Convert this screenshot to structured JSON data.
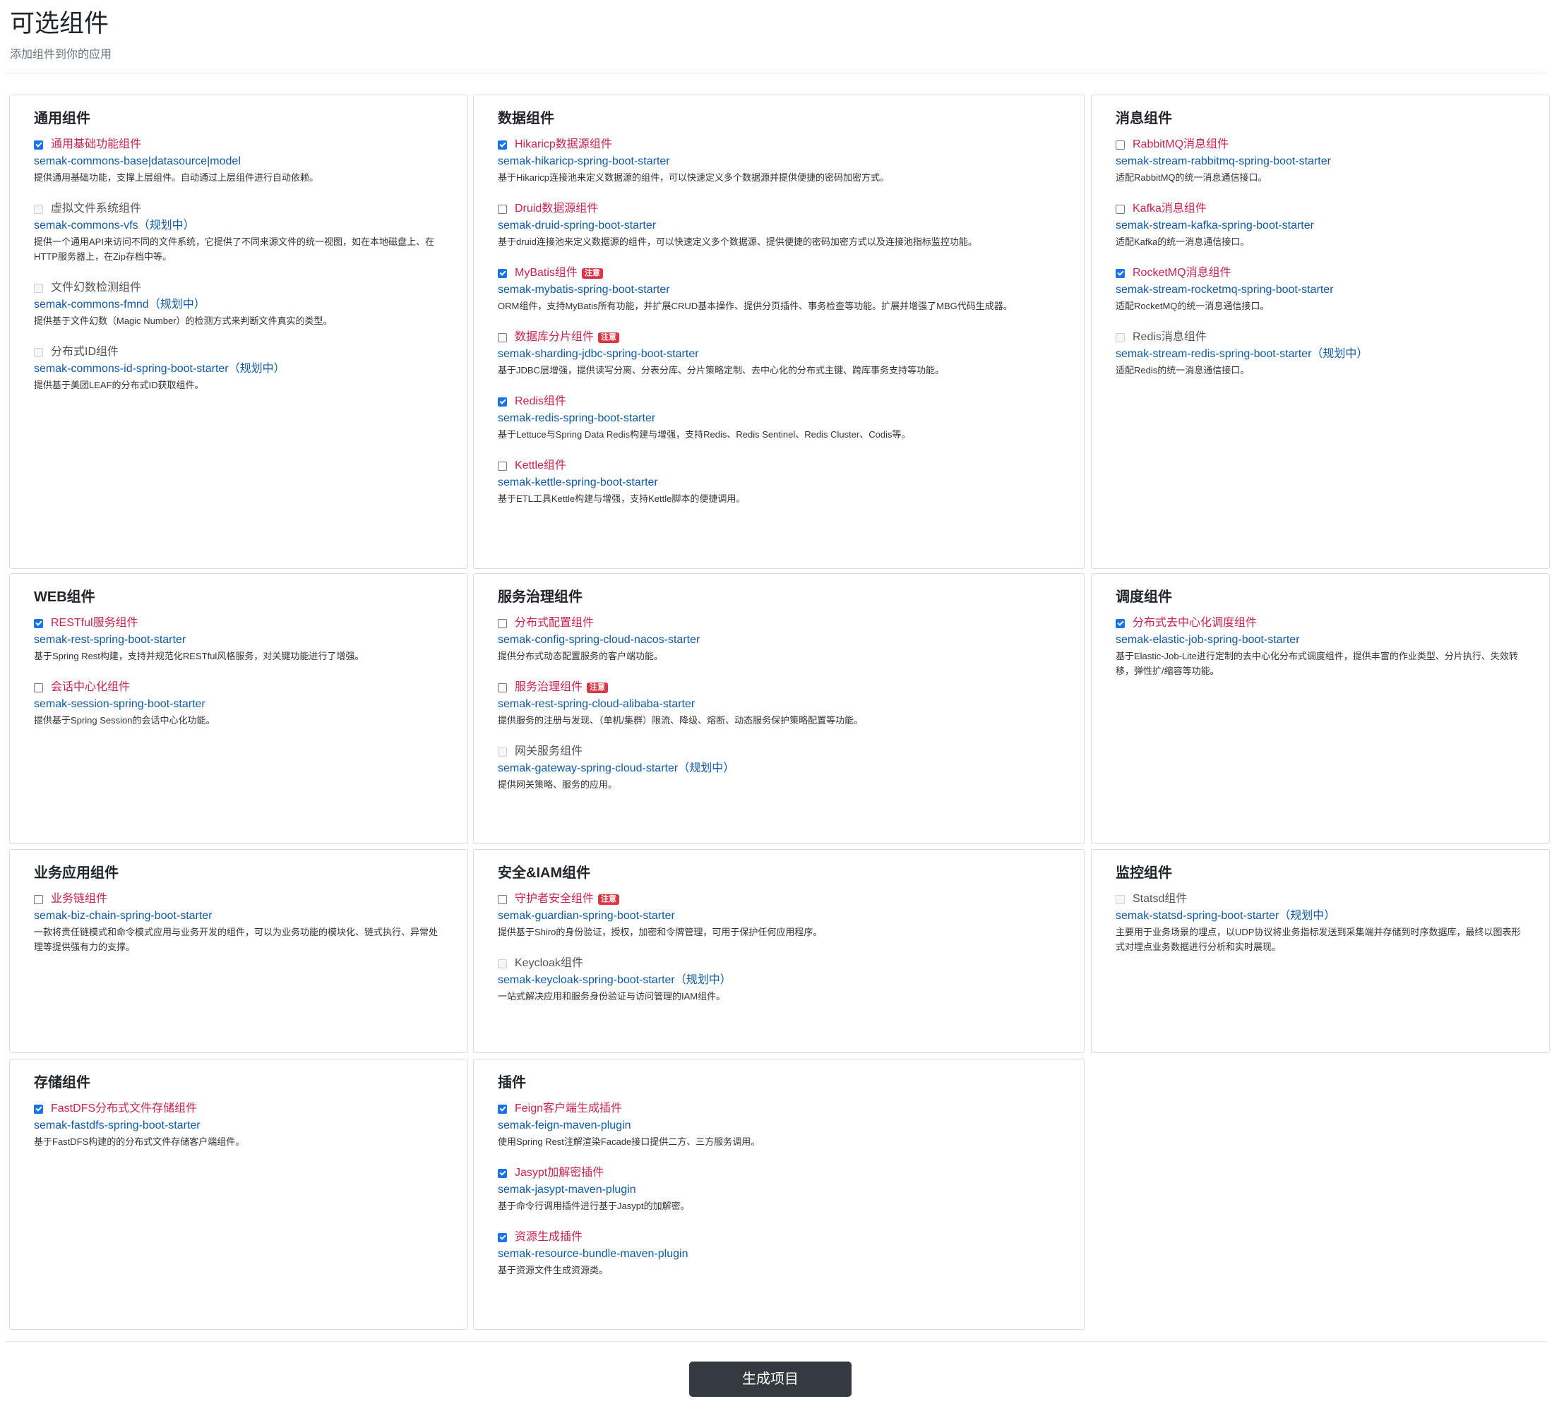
{
  "page": {
    "title": "可选组件",
    "subtitle": "添加组件到你的应用",
    "generate_label": "生成项目"
  },
  "badge_label": "注意",
  "cards": [
    {
      "title": "通用组件",
      "items": [
        {
          "name": "通用基础功能组件",
          "state": "checked",
          "artifact": "semak-commons-base|datasource|model",
          "desc": "提供通用基础功能，支撑上层组件。自动通过上层组件进行自动依赖。"
        },
        {
          "name": "虚拟文件系统组件",
          "state": "disabled",
          "artifact": "semak-commons-vfs（规划中）",
          "desc": "提供一个通用API来访问不同的文件系统，它提供了不同来源文件的统一视图，如在本地磁盘上、在HTTP服务器上，在Zip存档中等。"
        },
        {
          "name": "文件幻数检测组件",
          "state": "disabled",
          "artifact": "semak-commons-fmnd（规划中）",
          "desc": "提供基于文件幻数（Magic Number）的检测方式来判断文件真实的类型。"
        },
        {
          "name": "分布式ID组件",
          "state": "disabled",
          "artifact": "semak-commons-id-spring-boot-starter（规划中）",
          "desc": "提供基于美团LEAF的分布式ID获取组件。"
        }
      ]
    },
    {
      "title": "数据组件",
      "items": [
        {
          "name": "Hikaricp数据源组件",
          "state": "checked",
          "artifact": "semak-hikaricp-spring-boot-starter",
          "desc": "基于Hikaricp连接池来定义数据源的组件，可以快速定义多个数据源并提供便捷的密码加密方式。"
        },
        {
          "name": "Druid数据源组件",
          "state": "unchecked",
          "artifact": "semak-druid-spring-boot-starter",
          "desc": "基于druid连接池来定义数据源的组件，可以快速定义多个数据源、提供便捷的密码加密方式以及连接池指标监控功能。"
        },
        {
          "name": "MyBatis组件",
          "state": "checked",
          "badge": true,
          "artifact": "semak-mybatis-spring-boot-starter",
          "desc": "ORM组件，支持MyBatis所有功能，并扩展CRUD基本操作、提供分页插件、事务检查等功能。扩展并增强了MBG代码生成器。"
        },
        {
          "name": "数据库分片组件",
          "state": "unchecked",
          "badge": true,
          "artifact": "semak-sharding-jdbc-spring-boot-starter",
          "desc": "基于JDBC层增强，提供读写分离、分表分库、分片策略定制、去中心化的分布式主键、跨库事务支持等功能。"
        },
        {
          "name": "Redis组件",
          "state": "checked",
          "artifact": "semak-redis-spring-boot-starter",
          "desc": "基于Lettuce与Spring Data Redis构建与增强，支持Redis、Redis Sentinel、Redis Cluster、Codis等。"
        },
        {
          "name": "Kettle组件",
          "state": "unchecked",
          "artifact": "semak-kettle-spring-boot-starter",
          "desc": "基于ETL工具Kettle构建与增强，支持Kettle脚本的便捷调用。"
        }
      ]
    },
    {
      "title": "消息组件",
      "items": [
        {
          "name": "RabbitMQ消息组件",
          "state": "unchecked",
          "artifact": "semak-stream-rabbitmq-spring-boot-starter",
          "desc": "适配RabbitMQ的统一消息通信接口。"
        },
        {
          "name": "Kafka消息组件",
          "state": "unchecked",
          "artifact": "semak-stream-kafka-spring-boot-starter",
          "desc": "适配Kafka的统一消息通信接口。"
        },
        {
          "name": "RocketMQ消息组件",
          "state": "checked",
          "artifact": "semak-stream-rocketmq-spring-boot-starter",
          "desc": "适配RocketMQ的统一消息通信接口。"
        },
        {
          "name": "Redis消息组件",
          "state": "disabled",
          "artifact": "semak-stream-redis-spring-boot-starter（规划中）",
          "desc": "适配Redis的统一消息通信接口。"
        }
      ]
    },
    {
      "title": "WEB组件",
      "items": [
        {
          "name": "RESTful服务组件",
          "state": "checked",
          "artifact": "semak-rest-spring-boot-starter",
          "desc": "基于Spring Rest构建，支持并规范化RESTful风格服务，对关键功能进行了增强。"
        },
        {
          "name": "会话中心化组件",
          "state": "unchecked",
          "artifact": "semak-session-spring-boot-starter",
          "desc": "提供基于Spring Session的会话中心化功能。"
        }
      ]
    },
    {
      "title": "服务治理组件",
      "items": [
        {
          "name": "分布式配置组件",
          "state": "unchecked",
          "artifact": "semak-config-spring-cloud-nacos-starter",
          "desc": "提供分布式动态配置服务的客户端功能。"
        },
        {
          "name": "服务治理组件",
          "state": "unchecked",
          "badge": true,
          "artifact": "semak-rest-spring-cloud-alibaba-starter",
          "desc": "提供服务的注册与发现、（单机/集群）限流、降级、熔断、动态服务保护策略配置等功能。"
        },
        {
          "name": "网关服务组件",
          "state": "disabled",
          "artifact": "semak-gateway-spring-cloud-starter（规划中）",
          "desc": "提供网关策略、服务的应用。"
        }
      ]
    },
    {
      "title": "调度组件",
      "items": [
        {
          "name": "分布式去中心化调度组件",
          "state": "checked",
          "artifact": "semak-elastic-job-spring-boot-starter",
          "desc": "基于Elastic-Job-Lite进行定制的去中心化分布式调度组件，提供丰富的作业类型、分片执行、失效转移，弹性扩/缩容等功能。"
        }
      ]
    },
    {
      "title": "业务应用组件",
      "items": [
        {
          "name": "业务链组件",
          "state": "unchecked",
          "artifact": "semak-biz-chain-spring-boot-starter",
          "desc": "一款将责任链模式和命令模式应用与业务开发的组件，可以为业务功能的模块化、链式执行、异常处理等提供强有力的支撑。"
        }
      ]
    },
    {
      "title": "安全&IAM组件",
      "items": [
        {
          "name": "守护者安全组件",
          "state": "unchecked",
          "badge": true,
          "artifact": "semak-guardian-spring-boot-starter",
          "desc": "提供基于Shiro的身份验证，授权，加密和令牌管理，可用于保护任何应用程序。"
        },
        {
          "name": "Keycloak组件",
          "state": "disabled",
          "artifact": "semak-keycloak-spring-boot-starter（规划中）",
          "desc": "一站式解决应用和服务身份验证与访问管理的IAM组件。"
        }
      ]
    },
    {
      "title": "监控组件",
      "items": [
        {
          "name": "Statsd组件",
          "state": "disabled",
          "artifact": "semak-statsd-spring-boot-starter（规划中）",
          "desc": "主要用于业务场景的埋点，以UDP协议将业务指标发送到采集端并存储到时序数据库，最终以图表形式对埋点业务数据进行分析和实时展现。"
        }
      ]
    },
    {
      "title": "存储组件",
      "items": [
        {
          "name": "FastDFS分布式文件存储组件",
          "state": "checked",
          "artifact": "semak-fastdfs-spring-boot-starter",
          "desc": "基于FastDFS构建的的分布式文件存储客户端组件。"
        }
      ]
    },
    {
      "title": "插件",
      "items": [
        {
          "name": "Feign客户端生成插件",
          "state": "checked",
          "artifact": "semak-feign-maven-plugin",
          "desc": "使用Spring Rest注解渲染Facade接口提供二方、三方服务调用。"
        },
        {
          "name": "Jasypt加解密插件",
          "state": "checked",
          "artifact": "semak-jasypt-maven-plugin",
          "desc": "基于命令行调用插件进行基于Jasypt的加解密。"
        },
        {
          "name": "资源生成插件",
          "state": "checked",
          "artifact": "semak-resource-bundle-maven-plugin",
          "desc": "基于资源文件生成资源类。"
        }
      ]
    }
  ]
}
